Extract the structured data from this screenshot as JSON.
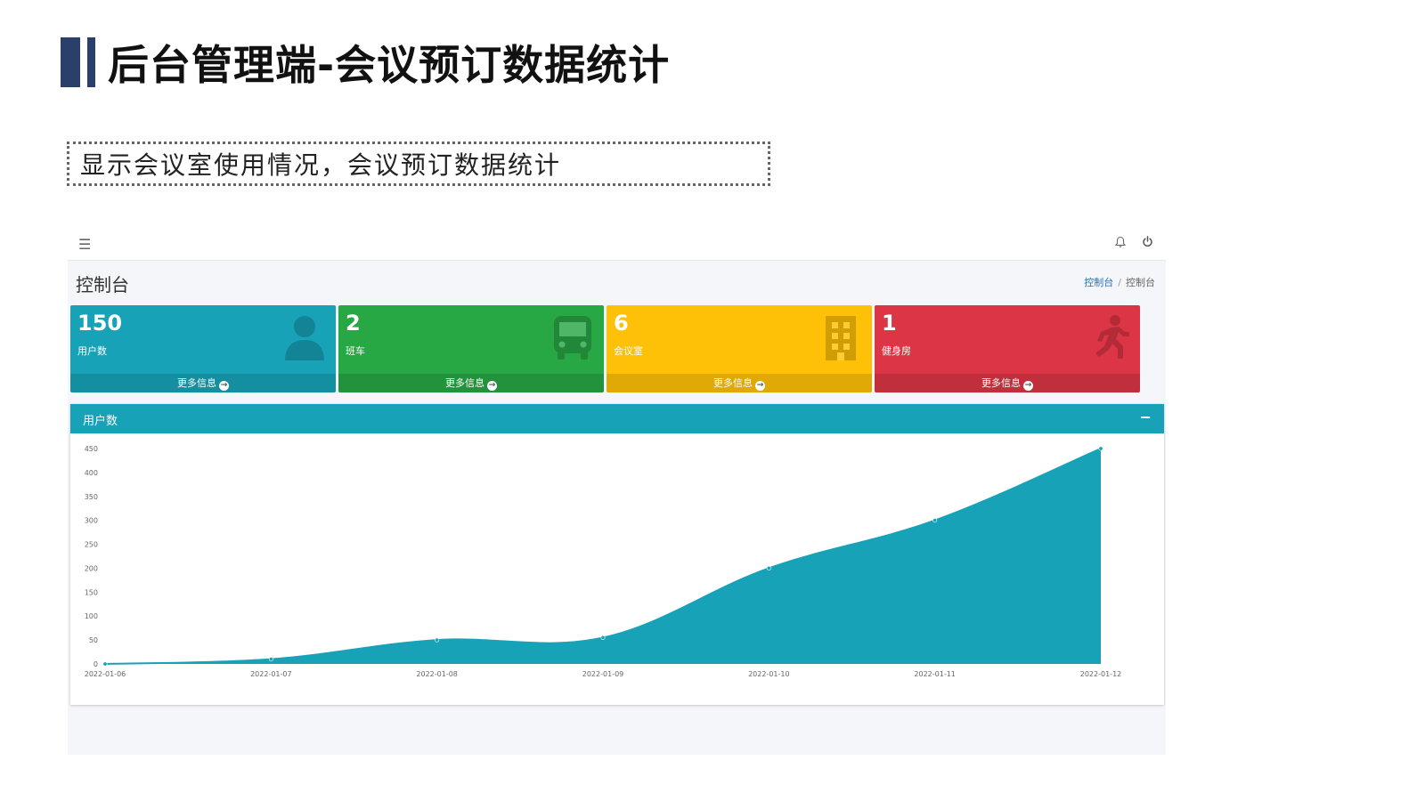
{
  "slide": {
    "title": "后台管理端-会议预订数据统计",
    "subtitle": "显示会议室使用情况，会议预订数据统计"
  },
  "app": {
    "topbar": {
      "menu_icon": "menu-icon",
      "bell_icon": "bell-icon",
      "power_icon": "power-icon"
    },
    "page_title": "控制台",
    "breadcrumb": {
      "link": "控制台",
      "separator": "/",
      "current": "控制台"
    },
    "stats": [
      {
        "number": "150",
        "label": "用户数",
        "footer": "更多信息",
        "icon": "user-icon",
        "color": "#17a2b8"
      },
      {
        "number": "2",
        "label": "班车",
        "footer": "更多信息",
        "icon": "bus-icon",
        "color": "#28a745"
      },
      {
        "number": "6",
        "label": "会议室",
        "footer": "更多信息",
        "icon": "building-icon",
        "color": "#ffc107"
      },
      {
        "number": "1",
        "label": "健身房",
        "footer": "更多信息",
        "icon": "running-icon",
        "color": "#dc3545"
      }
    ],
    "card": {
      "title": "用户数",
      "collapse": "−"
    }
  },
  "chart_data": {
    "type": "area",
    "x": [
      "2022-01-06",
      "2022-01-07",
      "2022-01-08",
      "2022-01-09",
      "2022-01-10",
      "2022-01-11",
      "2022-01-12"
    ],
    "series": [
      {
        "values": [
          0,
          10,
          50,
          55,
          200,
          300,
          450
        ]
      }
    ],
    "yticks": [
      0,
      50,
      100,
      150,
      200,
      250,
      300,
      350,
      400,
      450
    ],
    "ylim": [
      0,
      450
    ],
    "grid": false,
    "color": "#17a2b8"
  }
}
